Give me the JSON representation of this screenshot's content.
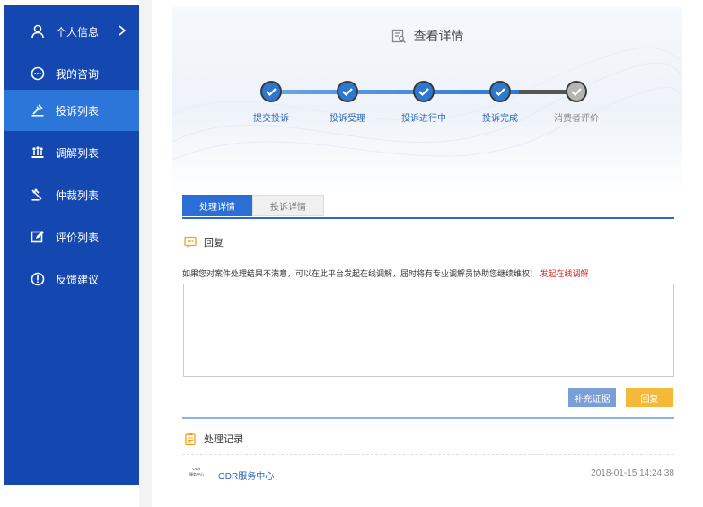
{
  "sidebar": {
    "items": [
      {
        "label": "个人信息",
        "icon": "user-icon"
      },
      {
        "label": "我的咨询",
        "icon": "chat-icon"
      },
      {
        "label": "投诉列表",
        "icon": "gavel-icon"
      },
      {
        "label": "调解列表",
        "icon": "mediation-icon"
      },
      {
        "label": "仲裁列表",
        "icon": "arbitration-icon"
      },
      {
        "label": "评价列表",
        "icon": "edit-icon"
      },
      {
        "label": "反馈建议",
        "icon": "info-icon"
      }
    ],
    "active_index": 2
  },
  "page": {
    "title": "查看详情"
  },
  "steps": [
    {
      "label": "提交投诉",
      "done": true
    },
    {
      "label": "投诉受理",
      "done": true
    },
    {
      "label": "投诉进行中",
      "done": true
    },
    {
      "label": "投诉完成",
      "done": true
    },
    {
      "label": "消费者评价",
      "done": false
    }
  ],
  "tabs": [
    {
      "label": "处理详情"
    },
    {
      "label": "投诉详情"
    }
  ],
  "reply": {
    "heading": "回复",
    "notice": "如果您对案件处理结果不满意，可以在此平台发起在线调解，届时将有专业调解员协助您继续维权！",
    "mediation_link": "发起在线调解",
    "evidence_button": "补充证据",
    "reply_button": "回复"
  },
  "records": {
    "heading": "处理记录",
    "items": [
      {
        "logo_top": "ODR",
        "logo_bottom": "服务中心",
        "org": "ODR服务中心",
        "time": "2018-01-15 14:24:38"
      }
    ]
  },
  "colors": {
    "sidebar": "#1447b0",
    "active": "#2b76d8",
    "accent": "#2a6ad0",
    "reply_button": "#f5b93a",
    "link": "#e02020"
  }
}
